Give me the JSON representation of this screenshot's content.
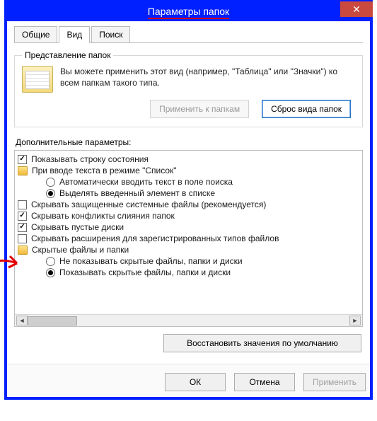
{
  "title": "Параметры папок",
  "close_glyph": "✕",
  "tabs": {
    "general": "Общие",
    "view": "Вид",
    "search": "Поиск"
  },
  "folder_view": {
    "legend": "Представление папок",
    "description": "Вы можете применить этот вид (например, \"Таблица\" или \"Значки\") ко всем папкам такого типа.",
    "apply_btn": "Применить к папкам",
    "reset_btn": "Сброс вида папок"
  },
  "adv": {
    "label": "Дополнительные параметры:",
    "items": [
      {
        "type": "check",
        "checked": true,
        "indent": 0,
        "text": "Показывать строку состояния"
      },
      {
        "type": "folder",
        "indent": 0,
        "text": "При вводе текста в режиме \"Список\""
      },
      {
        "type": "radio",
        "selected": false,
        "indent": 2,
        "text": "Автоматически вводить текст в поле поиска"
      },
      {
        "type": "radio",
        "selected": true,
        "indent": 2,
        "text": "Выделять введенный элемент в списке"
      },
      {
        "type": "check",
        "checked": false,
        "indent": 0,
        "text": "Скрывать защищенные системные файлы (рекомендуется)"
      },
      {
        "type": "check",
        "checked": true,
        "indent": 0,
        "text": "Скрывать конфликты слияния папок"
      },
      {
        "type": "check",
        "checked": true,
        "indent": 0,
        "text": "Скрывать пустые диски"
      },
      {
        "type": "check",
        "checked": false,
        "indent": 0,
        "text": "Скрывать расширения для зарегистрированных типов файлов"
      },
      {
        "type": "folder",
        "indent": 0,
        "text": "Скрытые файлы и папки"
      },
      {
        "type": "radio",
        "selected": false,
        "indent": 2,
        "text": "Не показывать скрытые файлы, папки и диски"
      },
      {
        "type": "radio",
        "selected": true,
        "indent": 2,
        "text": "Показывать скрытые файлы, папки и диски"
      }
    ],
    "restore_btn": "Восстановить значения по умолчанию"
  },
  "buttons": {
    "ok": "ОК",
    "cancel": "Отмена",
    "apply": "Применить"
  }
}
